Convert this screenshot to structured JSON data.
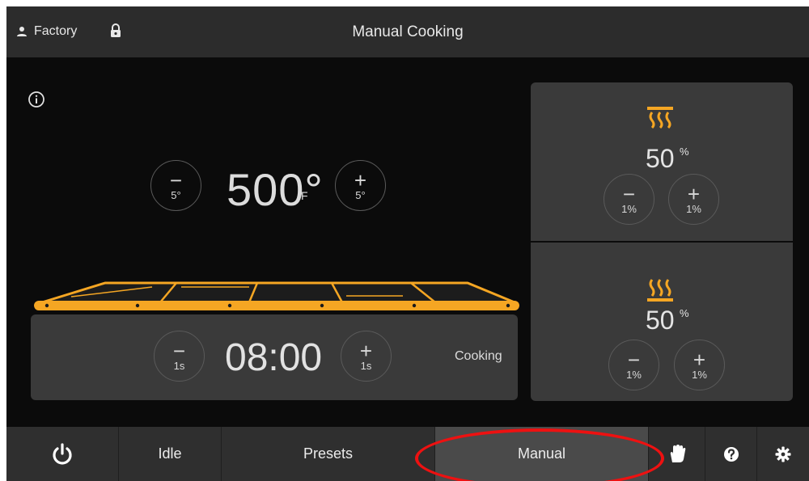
{
  "header": {
    "user_label": "Factory",
    "title": "Manual Cooking"
  },
  "temperature": {
    "value": "500°",
    "unit": "F",
    "decrease_step": "5°",
    "increase_step": "5°"
  },
  "timer": {
    "value": "08:00",
    "decrease_step": "1s",
    "increase_step": "1s",
    "status": "Cooking"
  },
  "top_heater": {
    "value": "50",
    "unit": "%",
    "decrease_step": "1%",
    "increase_step": "1%"
  },
  "bottom_heater": {
    "value": "50",
    "unit": "%",
    "decrease_step": "1%",
    "increase_step": "1%"
  },
  "footer": {
    "tabs": [
      "Idle",
      "Presets",
      "Manual"
    ],
    "active_tab": "Manual"
  },
  "icons": [
    "user-icon",
    "lock-icon",
    "info-icon",
    "top-heat-icon",
    "bottom-heat-icon",
    "power-icon",
    "hand-icon",
    "help-icon",
    "gear-icon"
  ],
  "colors": {
    "accent": "#f5a623",
    "header_bg": "#2c2c2c",
    "main_bg": "#0b0b0b",
    "panel_bg": "#3a3a3a",
    "active_tab_bg": "#4a4a4a",
    "highlight": "#ee1111"
  }
}
